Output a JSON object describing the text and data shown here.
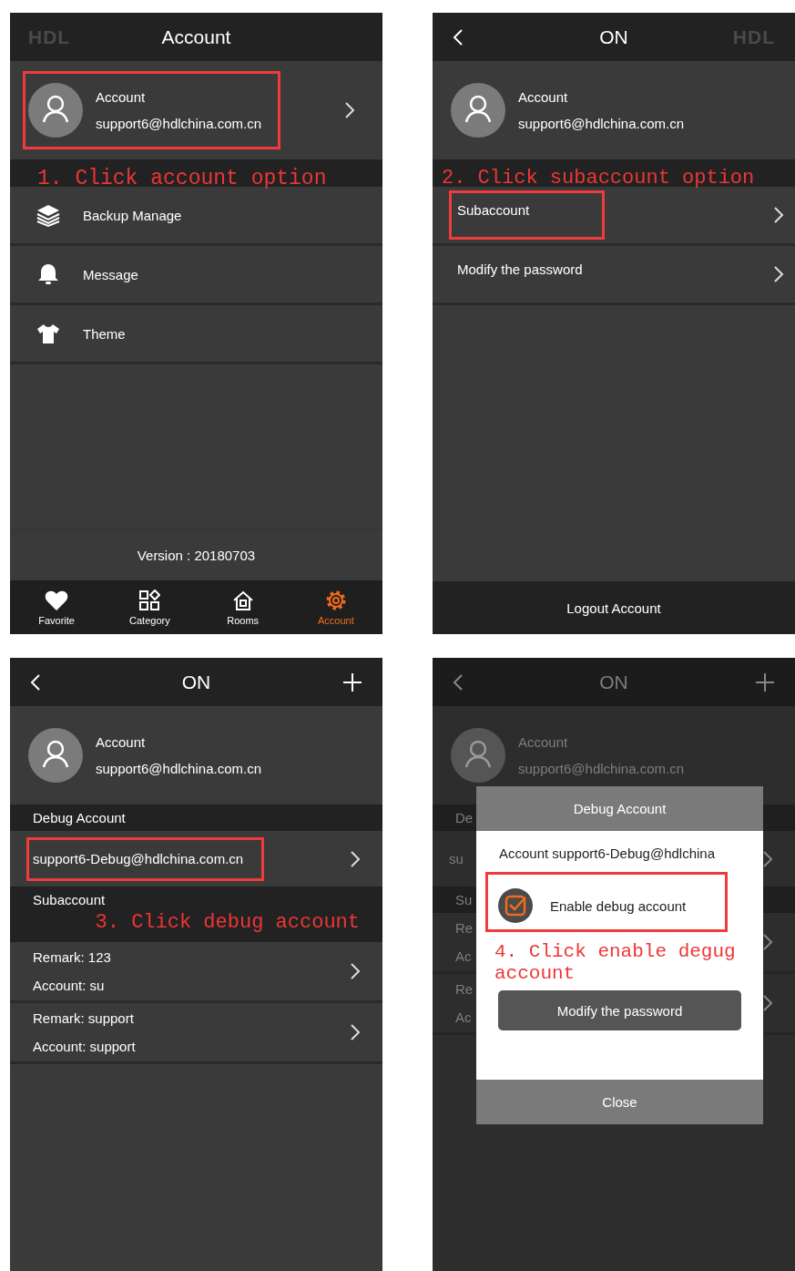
{
  "step1": {
    "header": {
      "logo": "HDL",
      "title": "Account"
    },
    "profile": {
      "label": "Account",
      "email": "support6@hdlchina.com.cn",
      "highlighted": true
    },
    "annotation": "1. Click account option",
    "menu": [
      {
        "label": "Backup Manage"
      },
      {
        "label": "Message"
      },
      {
        "label": "Theme"
      }
    ],
    "version": "Version : 20180703",
    "tabs": [
      {
        "label": "Favorite",
        "selected": false
      },
      {
        "label": "Category",
        "selected": false
      },
      {
        "label": "Rooms",
        "selected": false
      },
      {
        "label": "Account",
        "selected": true
      }
    ]
  },
  "step2": {
    "header": {
      "title": "ON",
      "logo": "HDL"
    },
    "profile": {
      "label": "Account",
      "email": "support6@hdlchina.com.cn"
    },
    "annotation": "2. Click subaccount option",
    "menu": [
      {
        "label": "Subaccount",
        "highlighted": true
      },
      {
        "label": "Modify the password"
      }
    ],
    "logout": "Logout Account"
  },
  "step3": {
    "header": {
      "title": "ON"
    },
    "profile": {
      "label": "Account",
      "email": "support6@hdlchina.com.cn"
    },
    "debug_section": "Debug Account",
    "debug_item": {
      "label": "support6-Debug@hdlchina.com.cn",
      "highlighted": true
    },
    "sub_section": "Subaccount",
    "annotation": "3. Click debug account",
    "subaccounts": [
      {
        "remark": "Remark: 123",
        "account": "Account: su"
      },
      {
        "remark": "Remark: support",
        "account": "Account: support"
      }
    ]
  },
  "step4": {
    "header": {
      "title": "ON"
    },
    "profile": {
      "label": "Account",
      "email": "support6@hdlchina.com.cn"
    },
    "background": {
      "debug_section": "De",
      "debug_item": "su",
      "sub_section": "Su",
      "subaccounts": [
        {
          "remark": "Re",
          "account": "Ac"
        },
        {
          "remark": "Re",
          "account": "Ac"
        }
      ]
    },
    "dialog": {
      "title": "Debug Account",
      "account_line": "Account support6-Debug@hdlchina",
      "option": {
        "label": "Enable debug account",
        "checked": true,
        "highlighted": true
      },
      "annotation": "4. Click enable degug account",
      "button": "Modify the password",
      "close": "Close"
    }
  }
}
